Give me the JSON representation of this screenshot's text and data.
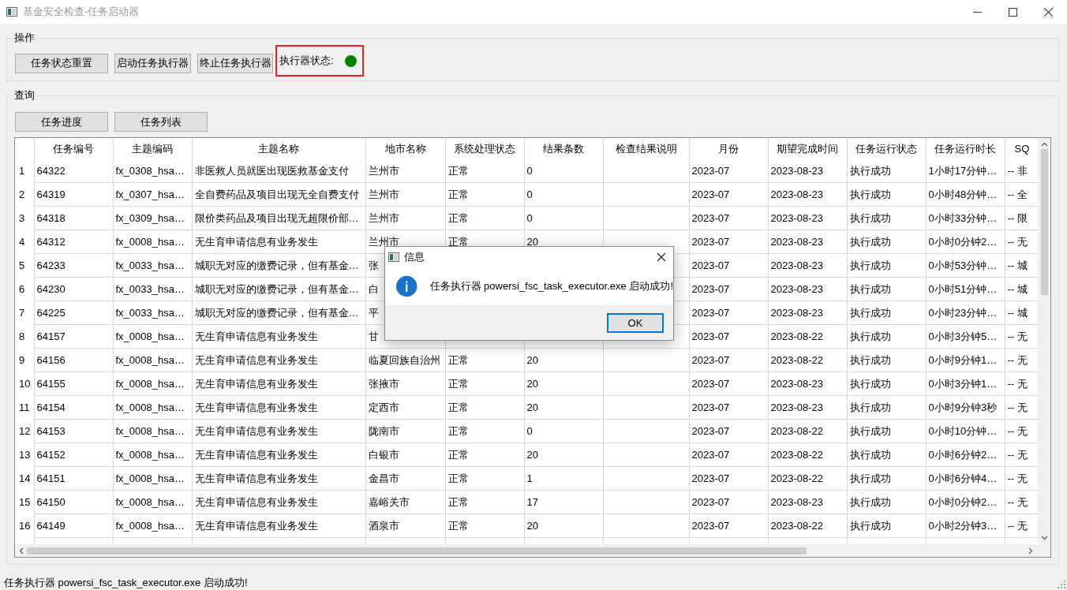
{
  "window": {
    "title": "基金安全检查-任务启动器"
  },
  "operations": {
    "title": "操作",
    "buttons": [
      "任务状态重置",
      "启动任务执行器",
      "终止任务执行器"
    ],
    "executor_status": {
      "label": "执行器状态:",
      "running": true,
      "highlighted": true
    }
  },
  "query": {
    "title": "查询",
    "buttons": [
      "任务进度",
      "任务列表"
    ],
    "table": {
      "columns": [
        "任务编号",
        "主题编码",
        "主题名称",
        "地市名称",
        "系统处理状态",
        "结果条数",
        "检查结果说明",
        "月份",
        "期望完成时间",
        "任务运行状态",
        "任务运行时长",
        "SQ"
      ],
      "rows": [
        {
          "number": "1",
          "cells": [
            "64322",
            "fx_0308_hsa…",
            "非医救人员就医出现医救基金支付",
            "兰州市",
            "正常",
            "0",
            null,
            "2023-07",
            "2023-08-23",
            "执行成功",
            "1小时17分钟…",
            "-- 非"
          ]
        },
        {
          "number": "2",
          "cells": [
            "64319",
            "fx_0307_hsa…",
            "全自费药品及项目出现无全自费支付",
            "兰州市",
            "正常",
            "0",
            null,
            "2023-07",
            "2023-08-23",
            "执行成功",
            "0小时48分钟…",
            "-- 全"
          ]
        },
        {
          "number": "3",
          "cells": [
            "64318",
            "fx_0309_hsa…",
            "限价类药品及项目出现无超限价部…",
            "兰州市",
            "正常",
            "0",
            null,
            "2023-07",
            "2023-08-23",
            "执行成功",
            "0小时33分钟…",
            "-- 限"
          ]
        },
        {
          "number": "4",
          "cells": [
            "64312",
            "fx_0008_hsa…",
            "无生育申请信息有业务发生",
            "兰州市",
            "正常",
            "20",
            null,
            "2023-07",
            "2023-08-23",
            "执行成功",
            "0小时0分钟2…",
            "-- 无"
          ]
        },
        {
          "number": "5",
          "cells": [
            "64233",
            "fx_0033_hsa…",
            "城职无对应的缴费记录，但有基金…",
            "张",
            null,
            null,
            null,
            "2023-07",
            "2023-08-23",
            "执行成功",
            "0小时53分钟…",
            "-- 城"
          ]
        },
        {
          "number": "6",
          "cells": [
            "64230",
            "fx_0033_hsa…",
            "城职无对应的缴费记录，但有基金…",
            "白",
            null,
            null,
            null,
            "2023-07",
            "2023-08-23",
            "执行成功",
            "0小时51分钟…",
            "-- 城"
          ]
        },
        {
          "number": "7",
          "cells": [
            "64225",
            "fx_0033_hsa…",
            "城职无对应的缴费记录，但有基金…",
            "平",
            null,
            null,
            null,
            "2023-07",
            "2023-08-23",
            "执行成功",
            "0小时23分钟…",
            "-- 城"
          ]
        },
        {
          "number": "8",
          "cells": [
            "64157",
            "fx_0008_hsa…",
            "无生育申请信息有业务发生",
            "甘",
            null,
            null,
            null,
            "2023-07",
            "2023-08-22",
            "执行成功",
            "0小时3分钟5…",
            "-- 无"
          ]
        },
        {
          "number": "9",
          "cells": [
            "64156",
            "fx_0008_hsa…",
            "无生育申请信息有业务发生",
            "临夏回族自治州",
            "正常",
            "20",
            null,
            "2023-07",
            "2023-08-22",
            "执行成功",
            "0小时9分钟1…",
            "-- 无"
          ]
        },
        {
          "number": "10",
          "cells": [
            "64155",
            "fx_0008_hsa…",
            "无生育申请信息有业务发生",
            "张掖市",
            "正常",
            "20",
            null,
            "2023-07",
            "2023-08-23",
            "执行成功",
            "0小时3分钟1…",
            "-- 无"
          ]
        },
        {
          "number": "11",
          "cells": [
            "64154",
            "fx_0008_hsa…",
            "无生育申请信息有业务发生",
            "定西市",
            "正常",
            "20",
            null,
            "2023-07",
            "2023-08-23",
            "执行成功",
            "0小时9分钟3秒",
            "-- 无"
          ]
        },
        {
          "number": "12",
          "cells": [
            "64153",
            "fx_0008_hsa…",
            "无生育申请信息有业务发生",
            "陇南市",
            "正常",
            "0",
            null,
            "2023-07",
            "2023-08-22",
            "执行成功",
            "0小时10分钟…",
            "-- 无"
          ]
        },
        {
          "number": "13",
          "cells": [
            "64152",
            "fx_0008_hsa…",
            "无生育申请信息有业务发生",
            "白银市",
            "正常",
            "20",
            null,
            "2023-07",
            "2023-08-22",
            "执行成功",
            "0小时6分钟2…",
            "-- 无"
          ]
        },
        {
          "number": "14",
          "cells": [
            "64151",
            "fx_0008_hsa…",
            "无生育申请信息有业务发生",
            "金昌市",
            "正常",
            "1",
            null,
            "2023-07",
            "2023-08-22",
            "执行成功",
            "0小时6分钟4…",
            "-- 无"
          ]
        },
        {
          "number": "15",
          "cells": [
            "64150",
            "fx_0008_hsa…",
            "无生育申请信息有业务发生",
            "嘉峪关市",
            "正常",
            "17",
            null,
            "2023-07",
            "2023-08-23",
            "执行成功",
            "0小时0分钟2…",
            "-- 无"
          ]
        },
        {
          "number": "16",
          "cells": [
            "64149",
            "fx_0008_hsa…",
            "无生育申请信息有业务发生",
            "酒泉市",
            "正常",
            "20",
            null,
            "2023-07",
            "2023-08-22",
            "执行成功",
            "0小时2分钟3…",
            "-- 无"
          ]
        }
      ]
    }
  },
  "dialog": {
    "title": "信息",
    "message": "任务执行器 powersi_fsc_task_executor.exe 启动成功!",
    "buttons": [
      {
        "label": "OK",
        "focused": true
      }
    ]
  },
  "status_bar": {
    "text": "任务执行器 powersi_fsc_task_executor.exe 启动成功!"
  }
}
